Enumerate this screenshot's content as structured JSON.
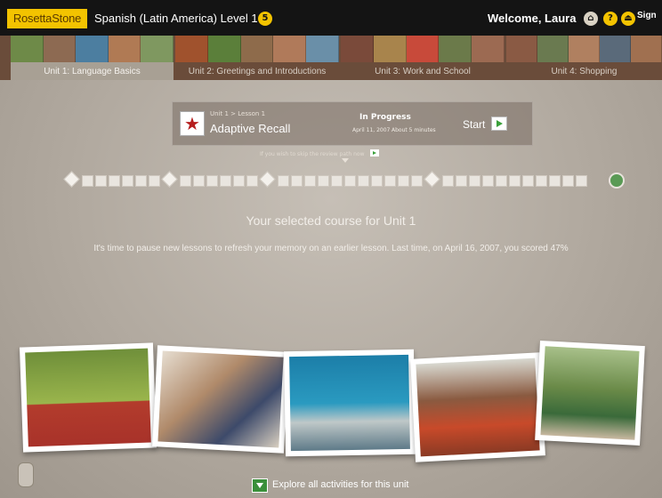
{
  "header": {
    "logo": "RosettaStone",
    "course": "Spanish (Latin America) Level 1",
    "course_badge": "5",
    "welcome": "Welcome, Laura",
    "signout": "Sign"
  },
  "units": [
    {
      "label": "Unit 1: Language Basics",
      "active": true
    },
    {
      "label": "Unit 2: Greetings and Introductions",
      "active": false
    },
    {
      "label": "Unit 3: Work and School",
      "active": false
    },
    {
      "label": "Unit 4: Shopping",
      "active": false
    }
  ],
  "lesson": {
    "path": "Unit 1 > Lesson 1",
    "title": "Adaptive Recall",
    "status": "In Progress",
    "date": "April 11, 2007",
    "duration": "About 5 minutes",
    "start_label": "Start"
  },
  "skip_text": "If you wish to skip the review path now",
  "heading": "Your selected course for Unit 1",
  "description": "It's time to pause new lessons to refresh your memory on an earlier lesson.  Last time, on April 16, 2007, you scored 47%",
  "explore_label": "Explore all activities for this unit",
  "colors": {
    "accent": "#f3c300",
    "go": "#3aa03a",
    "star": "#b51e1e"
  }
}
